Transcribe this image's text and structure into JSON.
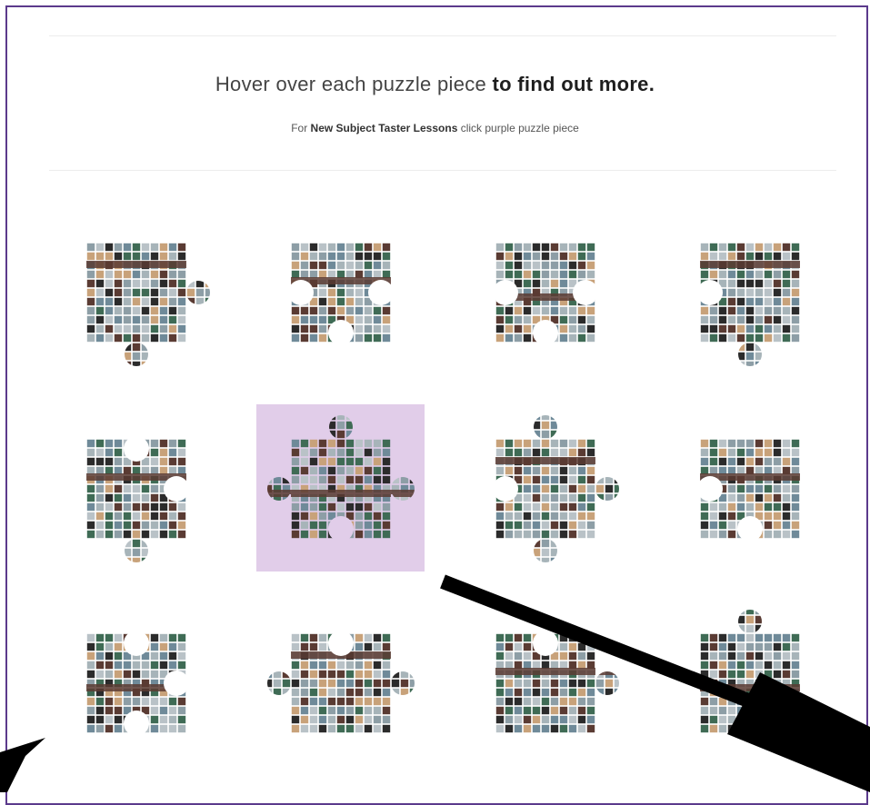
{
  "header": {
    "headline_plain": "Hover over each puzzle piece",
    "headline_bold": "to find out more.",
    "subline_prefix": "For",
    "subline_bold": "New Subject Taster Lessons",
    "subline_suffix": "click purple puzzle piece"
  },
  "colors": {
    "frame": "#5b3a8c",
    "highlight": "#e1cde9",
    "tile_grey": "#8d9ea6",
    "tile_dark": "#2b2b2b",
    "tile_brown": "#5a3b33",
    "tile_green": "#3f6b55"
  },
  "pieces": [
    {
      "name": "puzzle-piece-1",
      "highlighted": false
    },
    {
      "name": "puzzle-piece-2",
      "highlighted": false
    },
    {
      "name": "puzzle-piece-3",
      "highlighted": false
    },
    {
      "name": "puzzle-piece-4",
      "highlighted": false
    },
    {
      "name": "puzzle-piece-5",
      "highlighted": false
    },
    {
      "name": "puzzle-piece-6-new-subject-taster-lessons",
      "highlighted": true
    },
    {
      "name": "puzzle-piece-7",
      "highlighted": false
    },
    {
      "name": "puzzle-piece-8",
      "highlighted": false
    },
    {
      "name": "puzzle-piece-9",
      "highlighted": false
    },
    {
      "name": "puzzle-piece-10",
      "highlighted": false
    },
    {
      "name": "puzzle-piece-11",
      "highlighted": false
    },
    {
      "name": "puzzle-piece-12",
      "highlighted": false
    }
  ]
}
